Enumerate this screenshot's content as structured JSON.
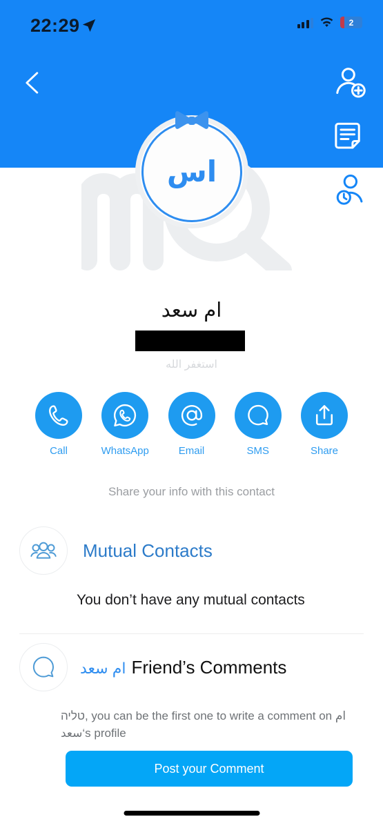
{
  "status_bar": {
    "time": "22:29",
    "location_icon": "location-arrow-icon",
    "signal_icon": "cellular-signal-icon",
    "wifi_icon": "wifi-icon",
    "battery_level": "2"
  },
  "header": {
    "back_icon": "back-chevron-icon",
    "add_contact_icon": "add-person-icon",
    "note_icon": "note-document-icon",
    "history_icon": "person-history-icon",
    "background_color": "#1586F7",
    "watermark": "mQ"
  },
  "profile": {
    "initials": "اس",
    "bowtie_icon": "bowtie-icon",
    "name": "ام سعد",
    "phone_redacted": true,
    "subtitle": "استغفر الله",
    "avatar_border_color": "#2E8DF0"
  },
  "actions": [
    {
      "label": "Call",
      "icon": "phone-icon"
    },
    {
      "label": "WhatsApp",
      "icon": "whatsapp-icon"
    },
    {
      "label": "Email",
      "icon": "at-sign-icon"
    },
    {
      "label": "SMS",
      "icon": "chat-bubble-icon"
    },
    {
      "label": "Share",
      "icon": "share-upload-icon"
    }
  ],
  "share_hint": "Share your info with this contact",
  "mutual": {
    "icon": "group-people-icon",
    "title": "Mutual Contacts",
    "empty_text": "You don’t have any mutual contacts"
  },
  "comments": {
    "icon": "comment-bubble-icon",
    "who": "ام سعد",
    "title": "Friend’s Comments",
    "body": "טליה, you can be the first one to write a comment on ام سعد‘s profile",
    "post_button": "Post your Comment",
    "post_button_color": "#04A6F7"
  }
}
